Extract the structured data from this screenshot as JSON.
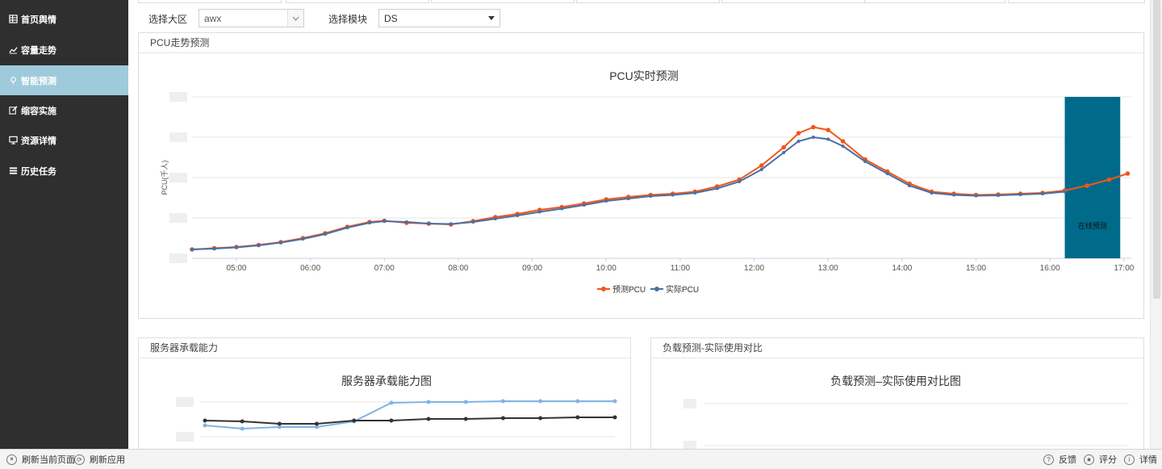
{
  "sidebar": {
    "items": [
      {
        "label": "首页舆情",
        "icon": "table-icon"
      },
      {
        "label": "容量走势",
        "icon": "line-chart-icon"
      },
      {
        "label": "智能预测",
        "icon": "lightbulb-icon",
        "active": true
      },
      {
        "label": "缩容实施",
        "icon": "edit-icon"
      },
      {
        "label": "资源详情",
        "icon": "monitor-icon"
      },
      {
        "label": "历史任务",
        "icon": "list-icon"
      }
    ]
  },
  "filters": {
    "region_label": "选择大区",
    "region_value": "awx",
    "module_label": "选择模块",
    "module_value": "DS"
  },
  "pcu_panel": {
    "header": "PCU走势预测",
    "chart_title": "PCU实时预测",
    "ylabel": "PCU(千人)",
    "band_label": "在线预测",
    "legend_predicted": "预测PCU",
    "legend_actual": "实际PCU"
  },
  "server_panel": {
    "header": "服务器承载能力",
    "chart_title": "服务器承载能力图"
  },
  "load_panel": {
    "header": "负载预测-实际使用对比",
    "chart_title": "负载预测–实际使用对比图"
  },
  "footer": {
    "refresh_page": "刷新当前页面",
    "refresh_app": "刷新应用",
    "feedback": "反馈",
    "rate": "评分",
    "details": "详情"
  },
  "colors": {
    "sidebar_bg": "#2f2f2f",
    "active_bg": "#9fcadb",
    "predicted": "#f0561a",
    "actual": "#4a6fa5",
    "band": "#006a8a",
    "light_blue": "#7fb4e6",
    "dark_line": "#333333"
  },
  "chart_data": [
    {
      "type": "line",
      "title": "PCU实时预测",
      "ylabel": "PCU(千人)",
      "xlabel": "",
      "x_ticks": [
        "05:00",
        "06:00",
        "07:00",
        "08:00",
        "09:00",
        "10:00",
        "11:00",
        "12:00",
        "13:00",
        "14:00",
        "15:00",
        "16:00",
        "17:00"
      ],
      "x_range": [
        4.4,
        17.1
      ],
      "ylim": [
        0,
        4
      ],
      "grid": true,
      "legend": "bottom-center",
      "band": {
        "from": 16.2,
        "to": 16.95,
        "label": "在线预测"
      },
      "series": [
        {
          "name": "预测PCU",
          "x": [
            4.4,
            4.7,
            5.0,
            5.3,
            5.6,
            5.9,
            6.2,
            6.5,
            6.8,
            7.0,
            7.3,
            7.6,
            7.9,
            8.2,
            8.5,
            8.8,
            9.1,
            9.4,
            9.7,
            10.0,
            10.3,
            10.6,
            10.9,
            11.2,
            11.5,
            11.8,
            12.1,
            12.4,
            12.6,
            12.8,
            13.0,
            13.2,
            13.5,
            13.8,
            14.1,
            14.4,
            14.7,
            15.0,
            15.3,
            15.6,
            15.9,
            16.2,
            16.5,
            16.8,
            17.05
          ],
          "values": [
            0.22,
            0.25,
            0.28,
            0.33,
            0.4,
            0.5,
            0.62,
            0.78,
            0.9,
            0.93,
            0.88,
            0.86,
            0.84,
            0.92,
            1.02,
            1.1,
            1.2,
            1.27,
            1.36,
            1.46,
            1.52,
            1.57,
            1.6,
            1.65,
            1.78,
            1.95,
            2.3,
            2.75,
            3.1,
            3.25,
            3.18,
            2.9,
            2.45,
            2.15,
            1.85,
            1.65,
            1.6,
            1.57,
            1.58,
            1.6,
            1.62,
            1.68,
            1.8,
            1.95,
            2.1
          ]
        },
        {
          "name": "实际PCU",
          "x": [
            4.4,
            4.7,
            5.0,
            5.3,
            5.6,
            5.9,
            6.2,
            6.5,
            6.8,
            7.0,
            7.3,
            7.6,
            7.9,
            8.2,
            8.5,
            8.8,
            9.1,
            9.4,
            9.7,
            10.0,
            10.3,
            10.6,
            10.9,
            11.2,
            11.5,
            11.8,
            12.1,
            12.4,
            12.6,
            12.8,
            13.0,
            13.2,
            13.5,
            13.8,
            14.1,
            14.4,
            14.7,
            15.0,
            15.3,
            15.6,
            15.9,
            16.2
          ],
          "values": [
            0.22,
            0.24,
            0.27,
            0.32,
            0.39,
            0.48,
            0.6,
            0.76,
            0.88,
            0.92,
            0.9,
            0.86,
            0.85,
            0.9,
            0.98,
            1.06,
            1.15,
            1.23,
            1.32,
            1.42,
            1.48,
            1.54,
            1.57,
            1.62,
            1.73,
            1.9,
            2.2,
            2.62,
            2.9,
            3.0,
            2.95,
            2.78,
            2.4,
            2.1,
            1.8,
            1.62,
            1.57,
            1.55,
            1.56,
            1.58,
            1.6,
            1.65
          ]
        }
      ]
    },
    {
      "type": "line",
      "title": "服务器承载能力图",
      "ylim": [
        0,
        1
      ],
      "grid": true,
      "series": [
        {
          "name": "",
          "values": [
            0.52,
            0.48,
            0.5,
            0.5,
            0.57,
            0.8,
            0.81,
            0.81,
            0.82,
            0.82,
            0.82,
            0.82
          ]
        },
        {
          "name": "",
          "values": [
            0.58,
            0.57,
            0.54,
            0.54,
            0.58,
            0.58,
            0.6,
            0.6,
            0.61,
            0.61,
            0.62,
            0.62
          ]
        }
      ]
    },
    {
      "type": "line",
      "title": "负载预测–实际使用对比图",
      "grid": true,
      "series": []
    }
  ]
}
